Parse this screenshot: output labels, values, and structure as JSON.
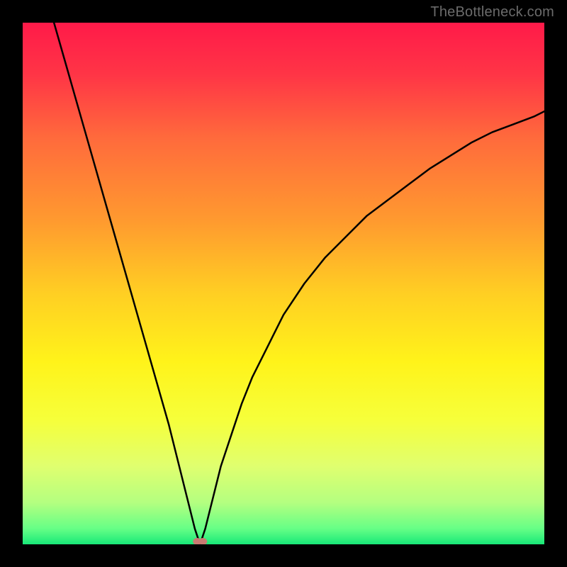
{
  "watermark": "TheBottleneck.com",
  "chart_data": {
    "type": "line",
    "title": "",
    "xlabel": "",
    "ylabel": "",
    "xlim": [
      0,
      100
    ],
    "ylim": [
      0,
      100
    ],
    "grid": false,
    "legend": false,
    "notes": "Background is a vertical rainbow gradient (red→orange→yellow→green from top to bottom). A black V-shaped curve descends from ~100 at x≈6 to 0 at x≈34, with a small marker at the minimum, then rises concavely toward ~83 at x=100.",
    "marker": {
      "x": 34,
      "y": 0,
      "color": "#c97a72"
    },
    "gradient_stops": [
      {
        "offset": 0.0,
        "color": "#ff1a49"
      },
      {
        "offset": 0.1,
        "color": "#ff3546"
      },
      {
        "offset": 0.22,
        "color": "#ff6a3c"
      },
      {
        "offset": 0.38,
        "color": "#ff9a2f"
      },
      {
        "offset": 0.52,
        "color": "#ffcf23"
      },
      {
        "offset": 0.65,
        "color": "#fff31a"
      },
      {
        "offset": 0.76,
        "color": "#f6ff3a"
      },
      {
        "offset": 0.85,
        "color": "#e0ff6f"
      },
      {
        "offset": 0.92,
        "color": "#b4ff80"
      },
      {
        "offset": 0.97,
        "color": "#66ff86"
      },
      {
        "offset": 1.0,
        "color": "#18e878"
      }
    ],
    "series": [
      {
        "name": "curve",
        "x": [
          6,
          8,
          10,
          12,
          14,
          16,
          18,
          20,
          22,
          24,
          26,
          28,
          30,
          31,
          32,
          33,
          34,
          35,
          36,
          37,
          38,
          40,
          42,
          44,
          46,
          48,
          50,
          54,
          58,
          62,
          66,
          70,
          74,
          78,
          82,
          86,
          90,
          94,
          98,
          100
        ],
        "y": [
          100,
          93,
          86,
          79,
          72,
          65,
          58,
          51,
          44,
          37,
          30,
          23,
          15,
          11,
          7,
          3,
          0,
          3,
          7,
          11,
          15,
          21,
          27,
          32,
          36,
          40,
          44,
          50,
          55,
          59,
          63,
          66,
          69,
          72,
          74.5,
          77,
          79,
          80.5,
          82,
          83
        ]
      }
    ]
  }
}
